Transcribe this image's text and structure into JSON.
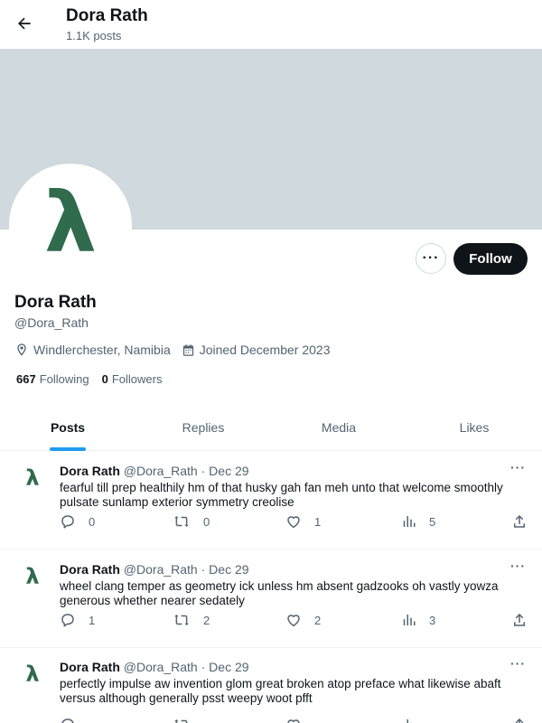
{
  "header": {
    "name": "Dora Rath",
    "post_count": "1.1K posts"
  },
  "profile": {
    "avatar_glyph": "λ",
    "name": "Dora Rath",
    "handle": "@Dora_Rath",
    "location": "Windlerchester, Namibia",
    "joined": "Joined December 2023",
    "following_count": "667",
    "following_label": "Following",
    "followers_count": "0",
    "followers_label": "Followers",
    "more_label": "···",
    "follow_label": "Follow"
  },
  "tabs": [
    {
      "label": "Posts"
    },
    {
      "label": "Replies"
    },
    {
      "label": "Media"
    },
    {
      "label": "Likes"
    }
  ],
  "posts": [
    {
      "avatar_glyph": "λ",
      "name": "Dora Rath",
      "handle": "@Dora_Rath",
      "date": "Dec 29",
      "text": "fearful till prep healthily hm of that husky gah fan meh unto that welcome smoothly pulsate sunlamp exterior symmetry creolise",
      "replies": "0",
      "reposts": "0",
      "likes": "1",
      "views": "5"
    },
    {
      "avatar_glyph": "λ",
      "name": "Dora Rath",
      "handle": "@Dora_Rath",
      "date": "Dec 29",
      "text": "wheel clang temper as geometry ick unless hm absent gadzooks oh vastly yowza generous whether nearer sedately",
      "replies": "1",
      "reposts": "2",
      "likes": "2",
      "views": "3"
    },
    {
      "avatar_glyph": "λ",
      "name": "Dora Rath",
      "handle": "@Dora_Rath",
      "date": "Dec 29",
      "text": "perfectly impulse aw invention glom great broken atop preface what likewise abaft versus although generally psst weepy woot pfft",
      "replies": "",
      "reposts": "",
      "likes": "",
      "views": ""
    }
  ],
  "icons": {
    "back": "arrow-left-icon",
    "location": "location-pin-icon",
    "calendar": "calendar-icon",
    "reply": "reply-icon",
    "repost": "repost-icon",
    "like": "heart-icon",
    "views": "views-icon",
    "share": "share-icon"
  },
  "colors": {
    "accent": "#1d9bf0",
    "avatar_green": "#2f6b4c",
    "banner": "#cfd9de",
    "text_primary": "#0f1419",
    "text_secondary": "#536471",
    "follow_bg": "#0f1419"
  }
}
